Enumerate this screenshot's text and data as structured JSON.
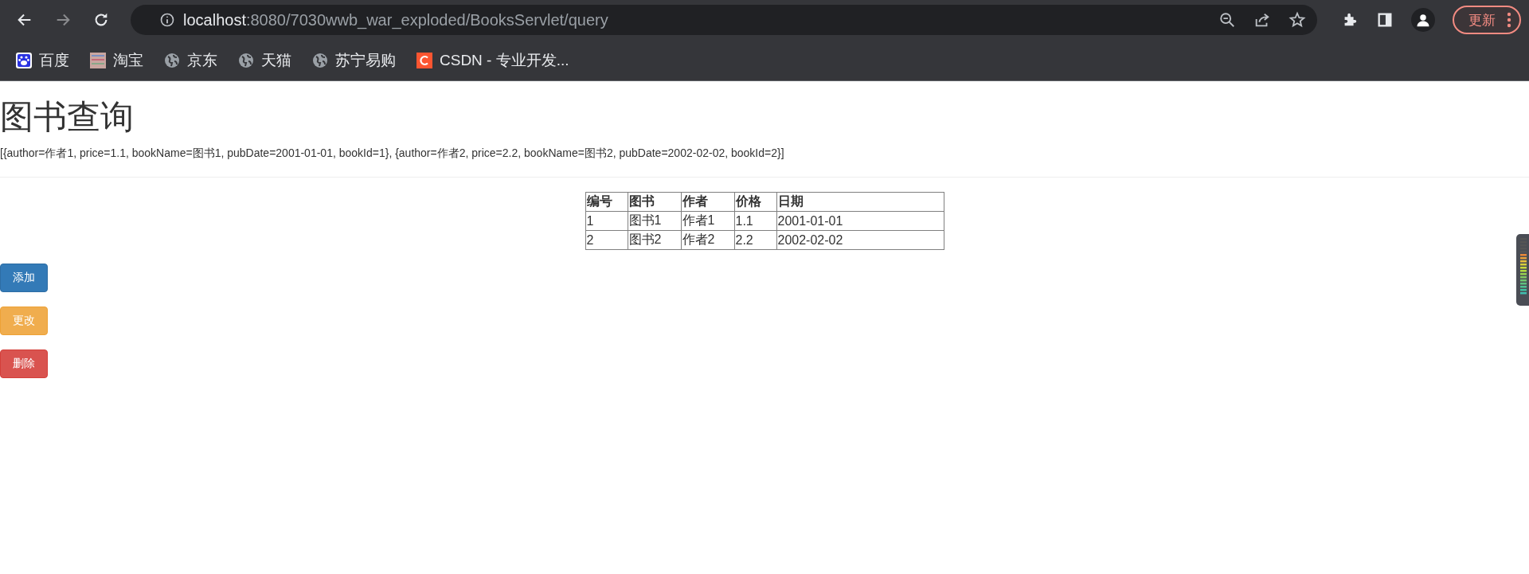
{
  "browser": {
    "forward_disabled": true,
    "url_host": "localhost",
    "url_path": ":8080/7030wwb_war_exploded/BooksServlet/query",
    "update_button": "更新",
    "bookmarks": [
      {
        "label": "百度",
        "kind": "baidu"
      },
      {
        "label": "淘宝",
        "kind": "taobao"
      },
      {
        "label": "京东",
        "kind": "globe"
      },
      {
        "label": "天猫",
        "kind": "globe"
      },
      {
        "label": "苏宁易购",
        "kind": "globe"
      },
      {
        "label": "CSDN - 专业开发...",
        "kind": "csdn"
      }
    ]
  },
  "page": {
    "title": "图书查询",
    "data_text": "[{author=作者1, price=1.1, bookName=图书1, pubDate=2001-01-01, bookId=1}, {author=作者2, price=2.2, bookName=图书2, pubDate=2002-02-02, bookId=2}]",
    "table": {
      "columns": [
        "编号",
        "图书",
        "作者",
        "价格",
        "日期"
      ],
      "rows": [
        [
          "1",
          "图书1",
          "作者1",
          "1.1",
          "2001-01-01"
        ],
        [
          "2",
          "图书2",
          "作者2",
          "2.2",
          "2002-02-02"
        ]
      ]
    },
    "buttons": [
      {
        "label": "添加",
        "kind": "primary"
      },
      {
        "label": "更改",
        "kind": "warning"
      },
      {
        "label": "删除",
        "kind": "danger"
      }
    ]
  }
}
